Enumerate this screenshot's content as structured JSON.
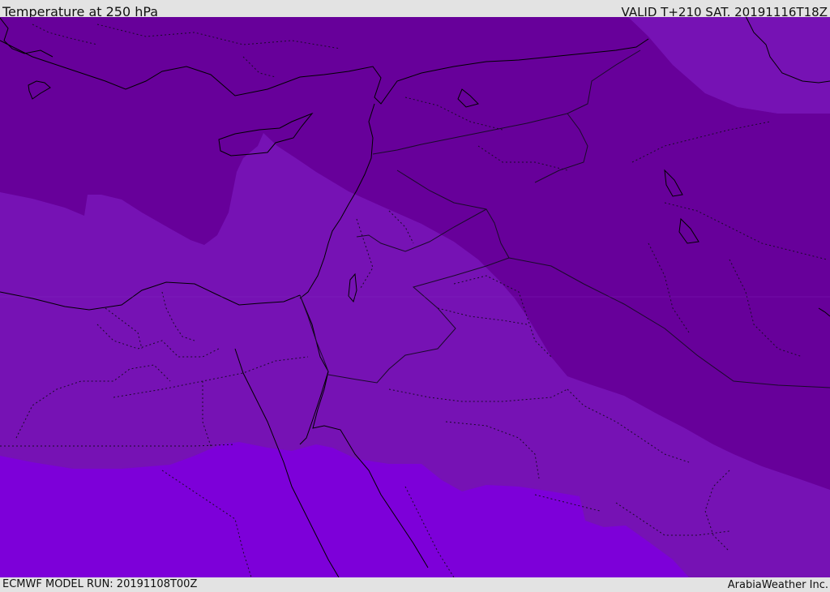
{
  "header": {
    "title": "Temperature at 250 hPa",
    "valid_time": "VALID T+210 SAT. 20191116T18Z"
  },
  "footer": {
    "model_run": "ECMWF MODEL RUN: 20191108T00Z",
    "credit": "ArabiaWeather Inc."
  },
  "map": {
    "field": "temperature-250hPa",
    "colors": {
      "coldest_band": "#67009a",
      "middle_band": "#7612b4",
      "warmest_band": "#7d00d9",
      "coastlines": "#000000",
      "borders": "#1a0a2a"
    }
  }
}
